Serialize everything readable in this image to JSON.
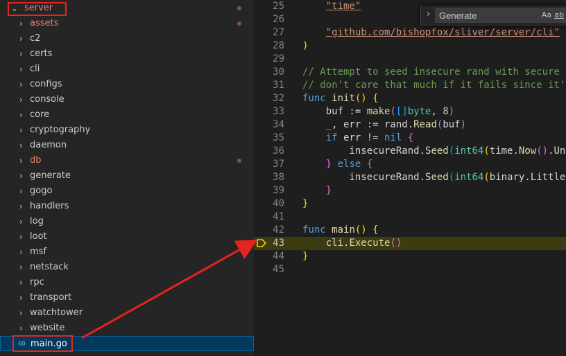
{
  "explorer": {
    "root": "server",
    "folders": [
      {
        "name": "assets",
        "modified": true
      },
      {
        "name": "c2",
        "modified": false
      },
      {
        "name": "certs",
        "modified": false
      },
      {
        "name": "cli",
        "modified": false
      },
      {
        "name": "configs",
        "modified": false
      },
      {
        "name": "console",
        "modified": false
      },
      {
        "name": "core",
        "modified": false
      },
      {
        "name": "cryptography",
        "modified": false
      },
      {
        "name": "daemon",
        "modified": false
      },
      {
        "name": "db",
        "modified": true
      },
      {
        "name": "generate",
        "modified": false
      },
      {
        "name": "gogo",
        "modified": false
      },
      {
        "name": "handlers",
        "modified": false
      },
      {
        "name": "log",
        "modified": false
      },
      {
        "name": "loot",
        "modified": false
      },
      {
        "name": "msf",
        "modified": false
      },
      {
        "name": "netstack",
        "modified": false
      },
      {
        "name": "rpc",
        "modified": false
      },
      {
        "name": "transport",
        "modified": false
      },
      {
        "name": "watchtower",
        "modified": false
      },
      {
        "name": "website",
        "modified": false
      }
    ],
    "selected_file": "main.go",
    "selected_file_icon": "GO"
  },
  "find_widget": {
    "value": "Generate",
    "match_case": "Aa",
    "whole_word": "ab"
  },
  "editor": {
    "current_line": 43,
    "lines": [
      {
        "n": "25",
        "tokens": [
          [
            "    ",
            ""
          ],
          [
            "\"time\"",
            "str"
          ]
        ]
      },
      {
        "n": "26",
        "tokens": []
      },
      {
        "n": "27",
        "tokens": [
          [
            "    ",
            ""
          ],
          [
            "\"github.com/bishopfox/sliver/server/cli\"",
            "str"
          ]
        ]
      },
      {
        "n": "28",
        "tokens": [
          [
            ")",
            "br1"
          ]
        ]
      },
      {
        "n": "29",
        "tokens": []
      },
      {
        "n": "30",
        "tokens": [
          [
            "// Attempt to seed insecure rand with secure",
            "cm"
          ]
        ]
      },
      {
        "n": "31",
        "tokens": [
          [
            "// don't care that much if it fails since it'",
            "cm"
          ]
        ]
      },
      {
        "n": "32",
        "tokens": [
          [
            "func ",
            "kw"
          ],
          [
            "init",
            "fn"
          ],
          [
            "() {",
            "br1"
          ]
        ]
      },
      {
        "n": "33",
        "tokens": [
          [
            "    buf := ",
            ""
          ],
          [
            "make",
            "fn"
          ],
          [
            "(",
            "br2"
          ],
          [
            "[]",
            "br3"
          ],
          [
            "byte",
            "ty"
          ],
          [
            ", ",
            ""
          ],
          [
            "8",
            "num"
          ],
          [
            ")",
            "br2"
          ]
        ]
      },
      {
        "n": "34",
        "tokens": [
          [
            "    _, err := rand.",
            ""
          ],
          [
            "Read",
            "fn"
          ],
          [
            "(",
            "br2"
          ],
          [
            "buf",
            ""
          ],
          [
            ")",
            "br2"
          ]
        ]
      },
      {
        "n": "35",
        "tokens": [
          [
            "    ",
            ""
          ],
          [
            "if ",
            "kw"
          ],
          [
            "err != ",
            ""
          ],
          [
            "nil ",
            "kw"
          ],
          [
            "{",
            "br2"
          ]
        ]
      },
      {
        "n": "36",
        "tokens": [
          [
            "        insecureRand.",
            ""
          ],
          [
            "Seed",
            "fn"
          ],
          [
            "(",
            "br3"
          ],
          [
            "int64",
            "ty"
          ],
          [
            "(",
            "br1"
          ],
          [
            "time.",
            ""
          ],
          [
            "Now",
            "fn"
          ],
          [
            "()",
            "br2"
          ],
          [
            ".Un",
            ""
          ]
        ]
      },
      {
        "n": "37",
        "tokens": [
          [
            "    ",
            ""
          ],
          [
            "}",
            "br2"
          ],
          [
            " else ",
            "kw"
          ],
          [
            "{",
            "br2"
          ]
        ]
      },
      {
        "n": "38",
        "tokens": [
          [
            "        insecureRand.",
            ""
          ],
          [
            "Seed",
            "fn"
          ],
          [
            "(",
            "br3"
          ],
          [
            "int64",
            "ty"
          ],
          [
            "(",
            "br1"
          ],
          [
            "binary.Little",
            ""
          ]
        ]
      },
      {
        "n": "39",
        "tokens": [
          [
            "    ",
            ""
          ],
          [
            "}",
            "br2"
          ]
        ]
      },
      {
        "n": "40",
        "tokens": [
          [
            "}",
            "br1"
          ]
        ]
      },
      {
        "n": "41",
        "tokens": []
      },
      {
        "n": "42",
        "tokens": [
          [
            "func ",
            "kw"
          ],
          [
            "main",
            "fn"
          ],
          [
            "() {",
            "br1"
          ]
        ]
      },
      {
        "n": "43",
        "tokens": [
          [
            "    cli.",
            ""
          ],
          [
            "Execute",
            "fn"
          ],
          [
            "()",
            "br2"
          ]
        ]
      },
      {
        "n": "44",
        "tokens": [
          [
            "}",
            "br1"
          ]
        ]
      },
      {
        "n": "45",
        "tokens": []
      }
    ]
  },
  "annotation_color": "#e8231f"
}
